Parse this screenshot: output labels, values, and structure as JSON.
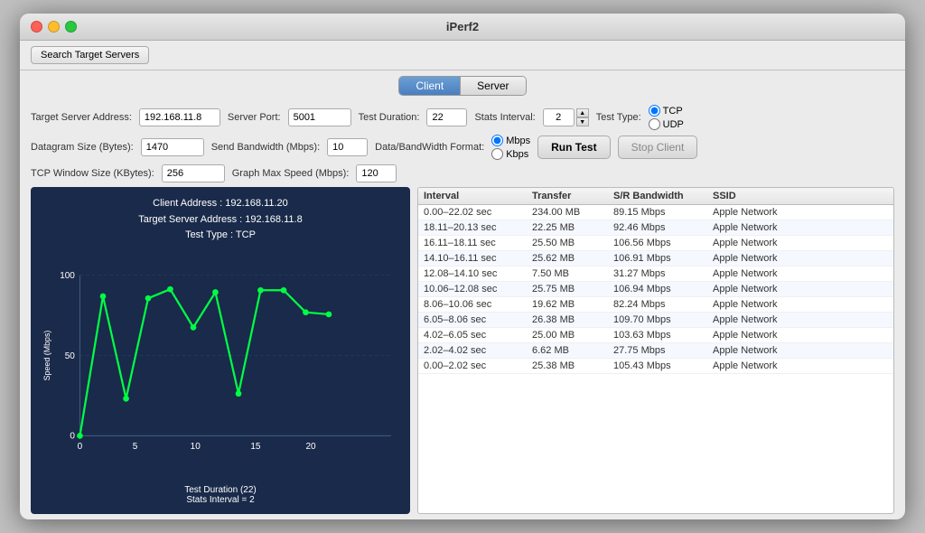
{
  "window": {
    "title": "iPerf2"
  },
  "toolbar": {
    "search_button": "Search Target Servers"
  },
  "tabs": {
    "client": "Client",
    "server": "Server",
    "active": "Client"
  },
  "form": {
    "target_server_label": "Target Server Address:",
    "target_server_value": "192.168.11.8",
    "server_port_label": "Server Port:",
    "server_port_value": "5001",
    "test_duration_label": "Test Duration:",
    "test_duration_value": "22",
    "stats_interval_label": "Stats Interval:",
    "stats_interval_value": "2",
    "test_type_label": "Test Type:",
    "datagram_size_label": "Datagram Size (Bytes):",
    "datagram_size_value": "1470",
    "send_bandwidth_label": "Send Bandwidth (Mbps):",
    "send_bandwidth_value": "10",
    "bandwidth_format_label": "Data/BandWidth Format:",
    "bandwidth_format_mbps": "Mbps",
    "bandwidth_format_kbps": "Kbps",
    "tcp_window_label": "TCP Window Size (KBytes):",
    "tcp_window_value": "256",
    "graph_max_label": "Graph Max Speed (Mbps):",
    "graph_max_value": "120",
    "run_test": "Run Test",
    "stop_client": "Stop Client"
  },
  "chart": {
    "client_address_label": "Client Address : 192.168.11.20",
    "target_server_label": "Target Server Address : 192.168.11.8",
    "test_type_label": "Test Type : TCP",
    "x_axis_label": "Test Duration (22)",
    "stats_interval_label": "Stats Interval = 2",
    "y_axis_label": "Speed (Mbps)",
    "x_ticks": [
      "0",
      "5",
      "10",
      "15",
      "20"
    ],
    "y_ticks": [
      "0",
      "50",
      "100"
    ]
  },
  "table": {
    "headers": [
      "Interval",
      "Transfer",
      "S/R Bandwidth",
      "SSID"
    ],
    "rows": [
      {
        "interval": "0.00–22.02 sec",
        "transfer": "234.00 MB",
        "bandwidth": "89.15 Mbps",
        "ssid": "Apple Network"
      },
      {
        "interval": "18.11–20.13 sec",
        "transfer": "22.25 MB",
        "bandwidth": "92.46 Mbps",
        "ssid": "Apple Network"
      },
      {
        "interval": "16.11–18.11 sec",
        "transfer": "25.50 MB",
        "bandwidth": "106.56 Mbps",
        "ssid": "Apple Network"
      },
      {
        "interval": "14.10–16.11 sec",
        "transfer": "25.62 MB",
        "bandwidth": "106.91 Mbps",
        "ssid": "Apple Network"
      },
      {
        "interval": "12.08–14.10 sec",
        "transfer": "7.50 MB",
        "bandwidth": "31.27 Mbps",
        "ssid": "Apple Network"
      },
      {
        "interval": "10.06–12.08 sec",
        "transfer": "25.75 MB",
        "bandwidth": "106.94 Mbps",
        "ssid": "Apple Network"
      },
      {
        "interval": "8.06–10.06 sec",
        "transfer": "19.62 MB",
        "bandwidth": "82.24 Mbps",
        "ssid": "Apple Network"
      },
      {
        "interval": "6.05–8.06 sec",
        "transfer": "26.38 MB",
        "bandwidth": "109.70 Mbps",
        "ssid": "Apple Network"
      },
      {
        "interval": "4.02–6.05 sec",
        "transfer": "25.00 MB",
        "bandwidth": "103.63 Mbps",
        "ssid": "Apple Network"
      },
      {
        "interval": "2.02–4.02 sec",
        "transfer": "6.62 MB",
        "bandwidth": "27.75 Mbps",
        "ssid": "Apple Network"
      },
      {
        "interval": "0.00–2.02 sec",
        "transfer": "25.38 MB",
        "bandwidth": "105.43 Mbps",
        "ssid": "Apple Network"
      }
    ]
  }
}
